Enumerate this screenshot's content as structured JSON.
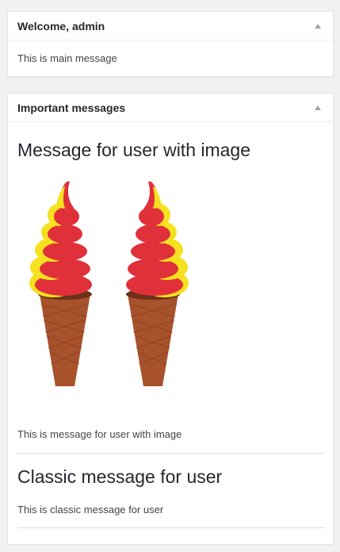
{
  "welcome_box": {
    "title": "Welcome, admin",
    "message": "This is main message"
  },
  "important_box": {
    "title": "Important messages",
    "messages": [
      {
        "heading": "Message for user with image",
        "image": "two-ice-cream-cones-image",
        "body": "This is message for user with image"
      },
      {
        "heading": "Classic message for user",
        "body": "This is classic message for user"
      }
    ]
  },
  "colors": {
    "background": "#f1f1f1",
    "panel": "#ffffff",
    "border": "#e5e5e5",
    "toggle_arrow": "#a0a5aa",
    "ice_cream_red": "#e0303a",
    "ice_cream_yellow": "#f5e11f",
    "cone_brown": "#a8522c"
  },
  "icons": {
    "toggle": "triangle-up-icon"
  }
}
